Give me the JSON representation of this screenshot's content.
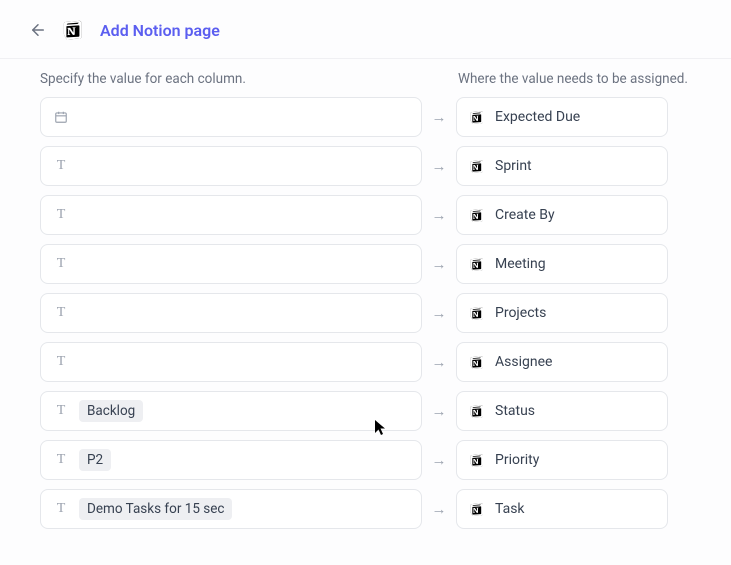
{
  "header": {
    "title": "Add Notion page"
  },
  "columns": {
    "left_header": "Specify the value for each column.",
    "right_header": "Where the value needs to be assigned."
  },
  "rows": [
    {
      "type": "date",
      "value": "",
      "target": "Expected Due"
    },
    {
      "type": "text",
      "value": "",
      "target": "Sprint"
    },
    {
      "type": "text",
      "value": "",
      "target": "Create By"
    },
    {
      "type": "text",
      "value": "",
      "target": "Meeting"
    },
    {
      "type": "text",
      "value": "",
      "target": "Projects"
    },
    {
      "type": "text",
      "value": "",
      "target": "Assignee"
    },
    {
      "type": "text",
      "value": "Backlog",
      "target": "Status"
    },
    {
      "type": "text",
      "value": "P2",
      "target": "Priority"
    },
    {
      "type": "text",
      "value": "Demo Tasks for 15 sec",
      "target": "Task"
    }
  ]
}
